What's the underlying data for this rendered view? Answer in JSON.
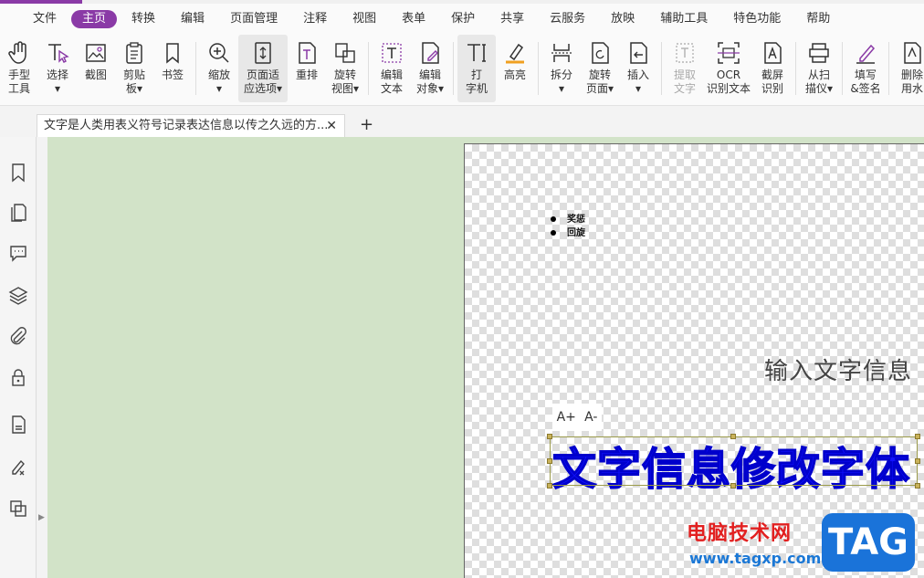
{
  "menu": {
    "items": [
      "文件",
      "主页",
      "转换",
      "编辑",
      "页面管理",
      "注释",
      "视图",
      "表单",
      "保护",
      "共享",
      "云服务",
      "放映",
      "辅助工具",
      "特色功能",
      "帮助"
    ],
    "active_index": 1
  },
  "ribbon": {
    "tools": [
      {
        "label": "手型\n工具",
        "icon": "hand-icon"
      },
      {
        "label": "选择\n▾",
        "icon": "select-text-icon"
      },
      {
        "label": "截图",
        "icon": "screenshot-icon"
      },
      {
        "label": "剪贴\n板▾",
        "icon": "clipboard-icon"
      },
      {
        "label": "书签",
        "icon": "bookmark-icon"
      },
      {
        "label": "缩放\n▾",
        "icon": "zoom-icon"
      },
      {
        "label": "页面适\n应选项▾",
        "icon": "fit-page-icon"
      },
      {
        "label": "重排",
        "icon": "reflow-icon"
      },
      {
        "label": "旋转\n视图▾",
        "icon": "rotate-view-icon"
      },
      {
        "label": "编辑\n文本",
        "icon": "edit-text-icon"
      },
      {
        "label": "编辑\n对象▾",
        "icon": "edit-object-icon"
      },
      {
        "label": "打\n字机",
        "icon": "typewriter-icon"
      },
      {
        "label": "高亮",
        "icon": "highlight-icon"
      },
      {
        "label": "拆分\n▾",
        "icon": "split-icon"
      },
      {
        "label": "旋转\n页面▾",
        "icon": "rotate-page-icon"
      },
      {
        "label": "插入\n▾",
        "icon": "insert-icon"
      },
      {
        "label": "提取\n文字",
        "icon": "extract-text-icon"
      },
      {
        "label": "OCR\n识别文本",
        "icon": "ocr-icon"
      },
      {
        "label": "截屏\n识别",
        "icon": "screen-ocr-icon"
      },
      {
        "label": "从扫\n描仪▾",
        "icon": "scanner-icon"
      },
      {
        "label": "填写\n&签名",
        "icon": "fill-sign-icon"
      },
      {
        "label": "删除\n用水",
        "icon": "remove-watermark-icon"
      }
    ]
  },
  "tabs": {
    "doc_title": "文字是人类用表义符号记录表达信息以传之久远的方...",
    "close": "✕",
    "add": "+"
  },
  "page": {
    "bullets": [
      "奖惩",
      "回旋"
    ],
    "input_text": "输入文字信息",
    "font_increase": "A+",
    "font_decrease": "A-",
    "selected_text": "文字信息修改字体"
  },
  "watermark": {
    "site_name": "电脑技术网",
    "url": "www.tagxp.com",
    "tag": "TAG"
  },
  "colors": {
    "accent": "#8a3aa6",
    "workspace": "#d2e3c8",
    "selected_text": "#1212ff"
  }
}
